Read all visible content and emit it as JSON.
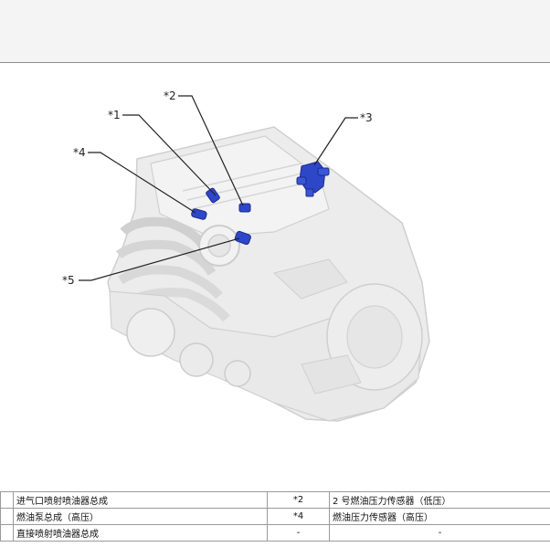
{
  "callouts": {
    "c1": "*1",
    "c2": "*2",
    "c3": "*3",
    "c4": "*4",
    "c5": "*5"
  },
  "legend": {
    "rows": [
      {
        "left_num": "",
        "left_text": "进气口喷射喷油器总成",
        "right_num": "*2",
        "right_text": "2 号燃油压力传感器（低压）"
      },
      {
        "left_num": "",
        "left_text": "燃油泵总成（高压）",
        "right_num": "*4",
        "right_text": "燃油压力传感器（高压）"
      },
      {
        "left_num": "",
        "left_text": "直接喷射喷油器总成",
        "right_num": "-",
        "right_text": "-"
      }
    ]
  },
  "colors": {
    "engine_body": "#ececec",
    "engine_line": "#c8c8c8",
    "highlight_part": "#2e47c9",
    "leader_line": "#222222"
  },
  "icons": {
    "engine": "engine-illustration"
  }
}
